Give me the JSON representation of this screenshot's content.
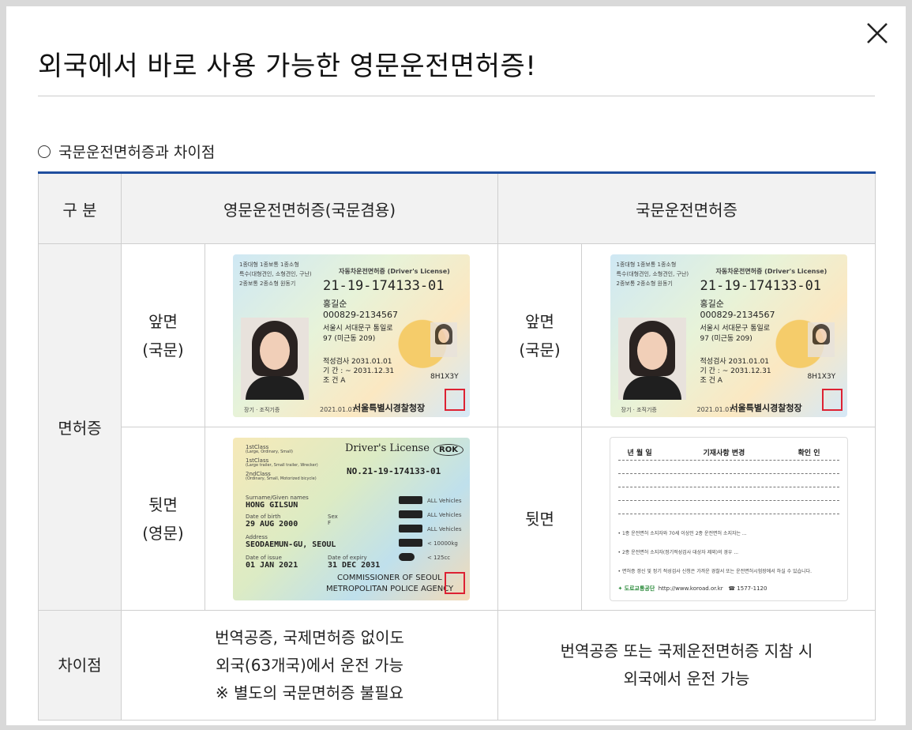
{
  "modal": {
    "title": "외국에서 바로 사용 가능한 영문운전면허증!",
    "section_heading": "국문운전면허증과 차이점"
  },
  "table": {
    "headers": [
      "구 분",
      "영문운전면허증(국문겸용)",
      "국문운전면허증"
    ],
    "row_label_license": "면허증",
    "front_label_line1": "앞면",
    "front_label_line2": "(국문)",
    "back_en_label_line1": "뒷면",
    "back_en_label_line2": "(영문)",
    "back_ko_label": "뒷면",
    "row_label_diff": "차이점",
    "diff_english": [
      "번역공증, 국제면허증 없이도",
      "외국(63개국)에서 운전 가능",
      "※ 별도의 국문면허증 불필요"
    ],
    "diff_korean": [
      "번역공증 또는 국제운전면허증 지참 시",
      "외국에서 운전 가능"
    ]
  },
  "card_front": {
    "class_line1": "1종대형 1종보통 1종소형",
    "class_line2": "특수(대형견인, 소형견인, 구난)",
    "class_line3": "2종보통 2종소형 원동기",
    "header": "자동차운전면허증 (Driver's License)",
    "number": "21-19-174133-01",
    "name": "홍길순",
    "id_no": "000829-2134567",
    "addr1": "서울시 서대문구 통일로",
    "addr2": "97 (미근동 209)",
    "aptitude": "적성검사   2031.01.01",
    "period": "기    간 : ~ 2031.12.31",
    "cond": "조    건   A",
    "code": "8H1X3Y",
    "bottom_left": "장기 · 조직기증",
    "issue_date": "2021.01.01.",
    "issuer": "서울특별시경찰청장"
  },
  "card_back_en": {
    "title": "Driver's License",
    "rok": "ROK",
    "number": "NO.21-19-174133-01",
    "class1": "1stClass",
    "class1_sub": "(Large, Ordinary, Small)",
    "class1b": "1stClass",
    "class1b_sub": "(Large trailer, Small trailer, Wrecker)",
    "class2": "2ndClass",
    "class2_sub": "(Ordinary, Small, Motorized bicycle)",
    "name_label": "Surname/Given names",
    "name": "HONG GILSUN",
    "dob_label": "Date of birth",
    "dob": "29 AUG 2000",
    "sex_label": "Sex",
    "sex": "F",
    "address_label": "Address",
    "address": "SEODAEMUN-GU, SEOUL",
    "issue_label": "Date of issue",
    "issue": "01 JAN 2021",
    "expiry_label": "Date of expiry",
    "expiry": "31 DEC 2031",
    "vehicle_all": "ALL Vehicles",
    "veh_weight": "< 10000kg",
    "veh_cc": "< 125cc",
    "issuer1": "COMMISSIONER OF SEOUL",
    "issuer2": "METROPOLITAN POLICE AGENCY"
  },
  "card_back_ko": {
    "col1": "년  월  일",
    "col2": "기재사항 변경",
    "col3": "확인 인",
    "note1": "• 1종 운전면허 소지자와 70세 이상인 2종 운전면허 소지자는 ...",
    "note2": "• 2종 운전면허 소지자(정기적성검사 대상자 제외)의 경우 ...",
    "note3": "• 면허증 갱신 및 정기 적성검사 신청은 가까운 경찰서 또는 운전면허시험장에서 하실 수 있습니다.",
    "org": "도로교통공단",
    "url": "http://www.koroad.or.kr",
    "phone": "☎ 1577-1120"
  }
}
